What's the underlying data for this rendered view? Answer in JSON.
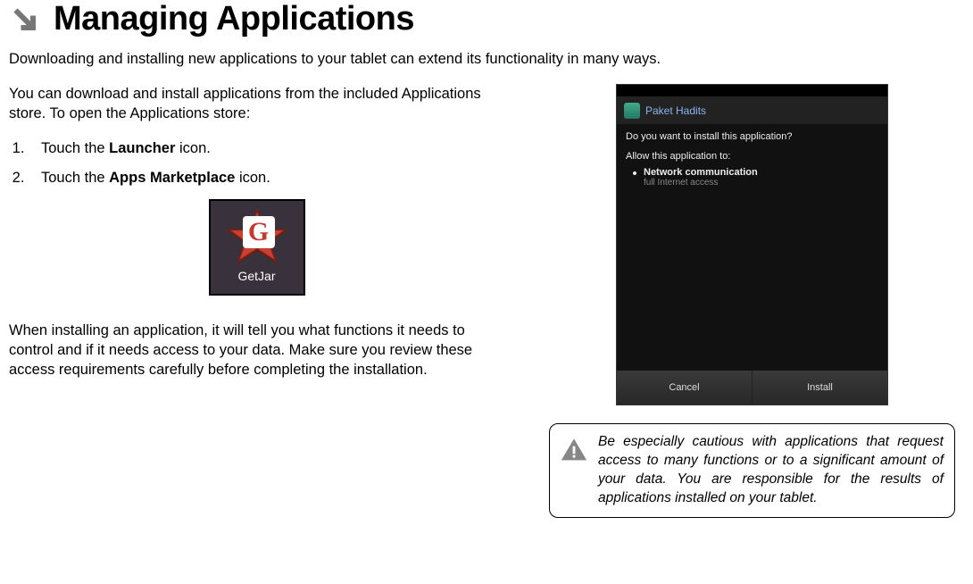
{
  "heading": {
    "title": "Managing Applications"
  },
  "intro": "Downloading and installing new applications to your tablet can extend its functionality in many ways.",
  "left": {
    "store_intro": "You can download and install applications from the included Applications store. To open the Applications store:",
    "step1_prefix": "Touch the ",
    "step1_bold": "Launcher",
    "step1_suffix": " icon.",
    "step2_prefix": "Touch the ",
    "step2_bold": "Apps Marketplace",
    "step2_suffix": " icon.",
    "getjar_label": "GetJar",
    "install_para": "When installing an application, it will tell you what functions it needs to control and if it needs access to your data. Make sure you review these access requirements carefully before completing the installation."
  },
  "dialog": {
    "app_name": "Paket Hadits",
    "question": "Do you want to install this application?",
    "allow": "Allow this application to:",
    "perm_title": "Network communication",
    "perm_sub": "full Internet access",
    "cancel": "Cancel",
    "install": "Install"
  },
  "warning": {
    "text": "Be especially cautious with applications that request access to many functions or to a significant amount of your data. You are responsible for the results of applications installed on your tablet."
  }
}
